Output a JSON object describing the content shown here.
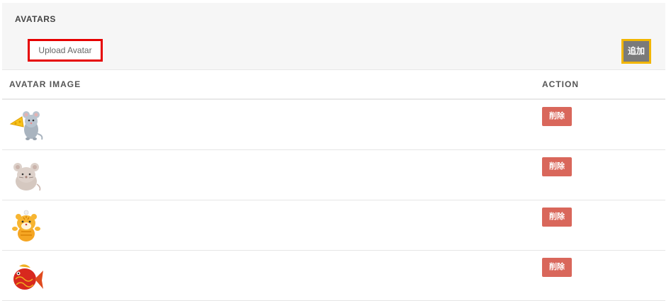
{
  "section": {
    "title": "AVATARS"
  },
  "toolbar": {
    "upload_label": "Upload Avatar",
    "add_label": "追加"
  },
  "table": {
    "headers": {
      "image": "AVATAR IMAGE",
      "action": "ACTION"
    },
    "rows": [
      {
        "avatar": "mouse-with-cheese-icon",
        "delete_label": "削除"
      },
      {
        "avatar": "mouse-icon",
        "delete_label": "削除"
      },
      {
        "avatar": "tiger-icon",
        "delete_label": "削除"
      },
      {
        "avatar": "fish-icon",
        "delete_label": "削除"
      }
    ]
  },
  "colors": {
    "header_bg": "#f6f6f6",
    "upload_border": "#e60000",
    "add_border": "#f2b600",
    "add_bg": "#7a7a7a",
    "delete_bg": "#d9675b"
  }
}
